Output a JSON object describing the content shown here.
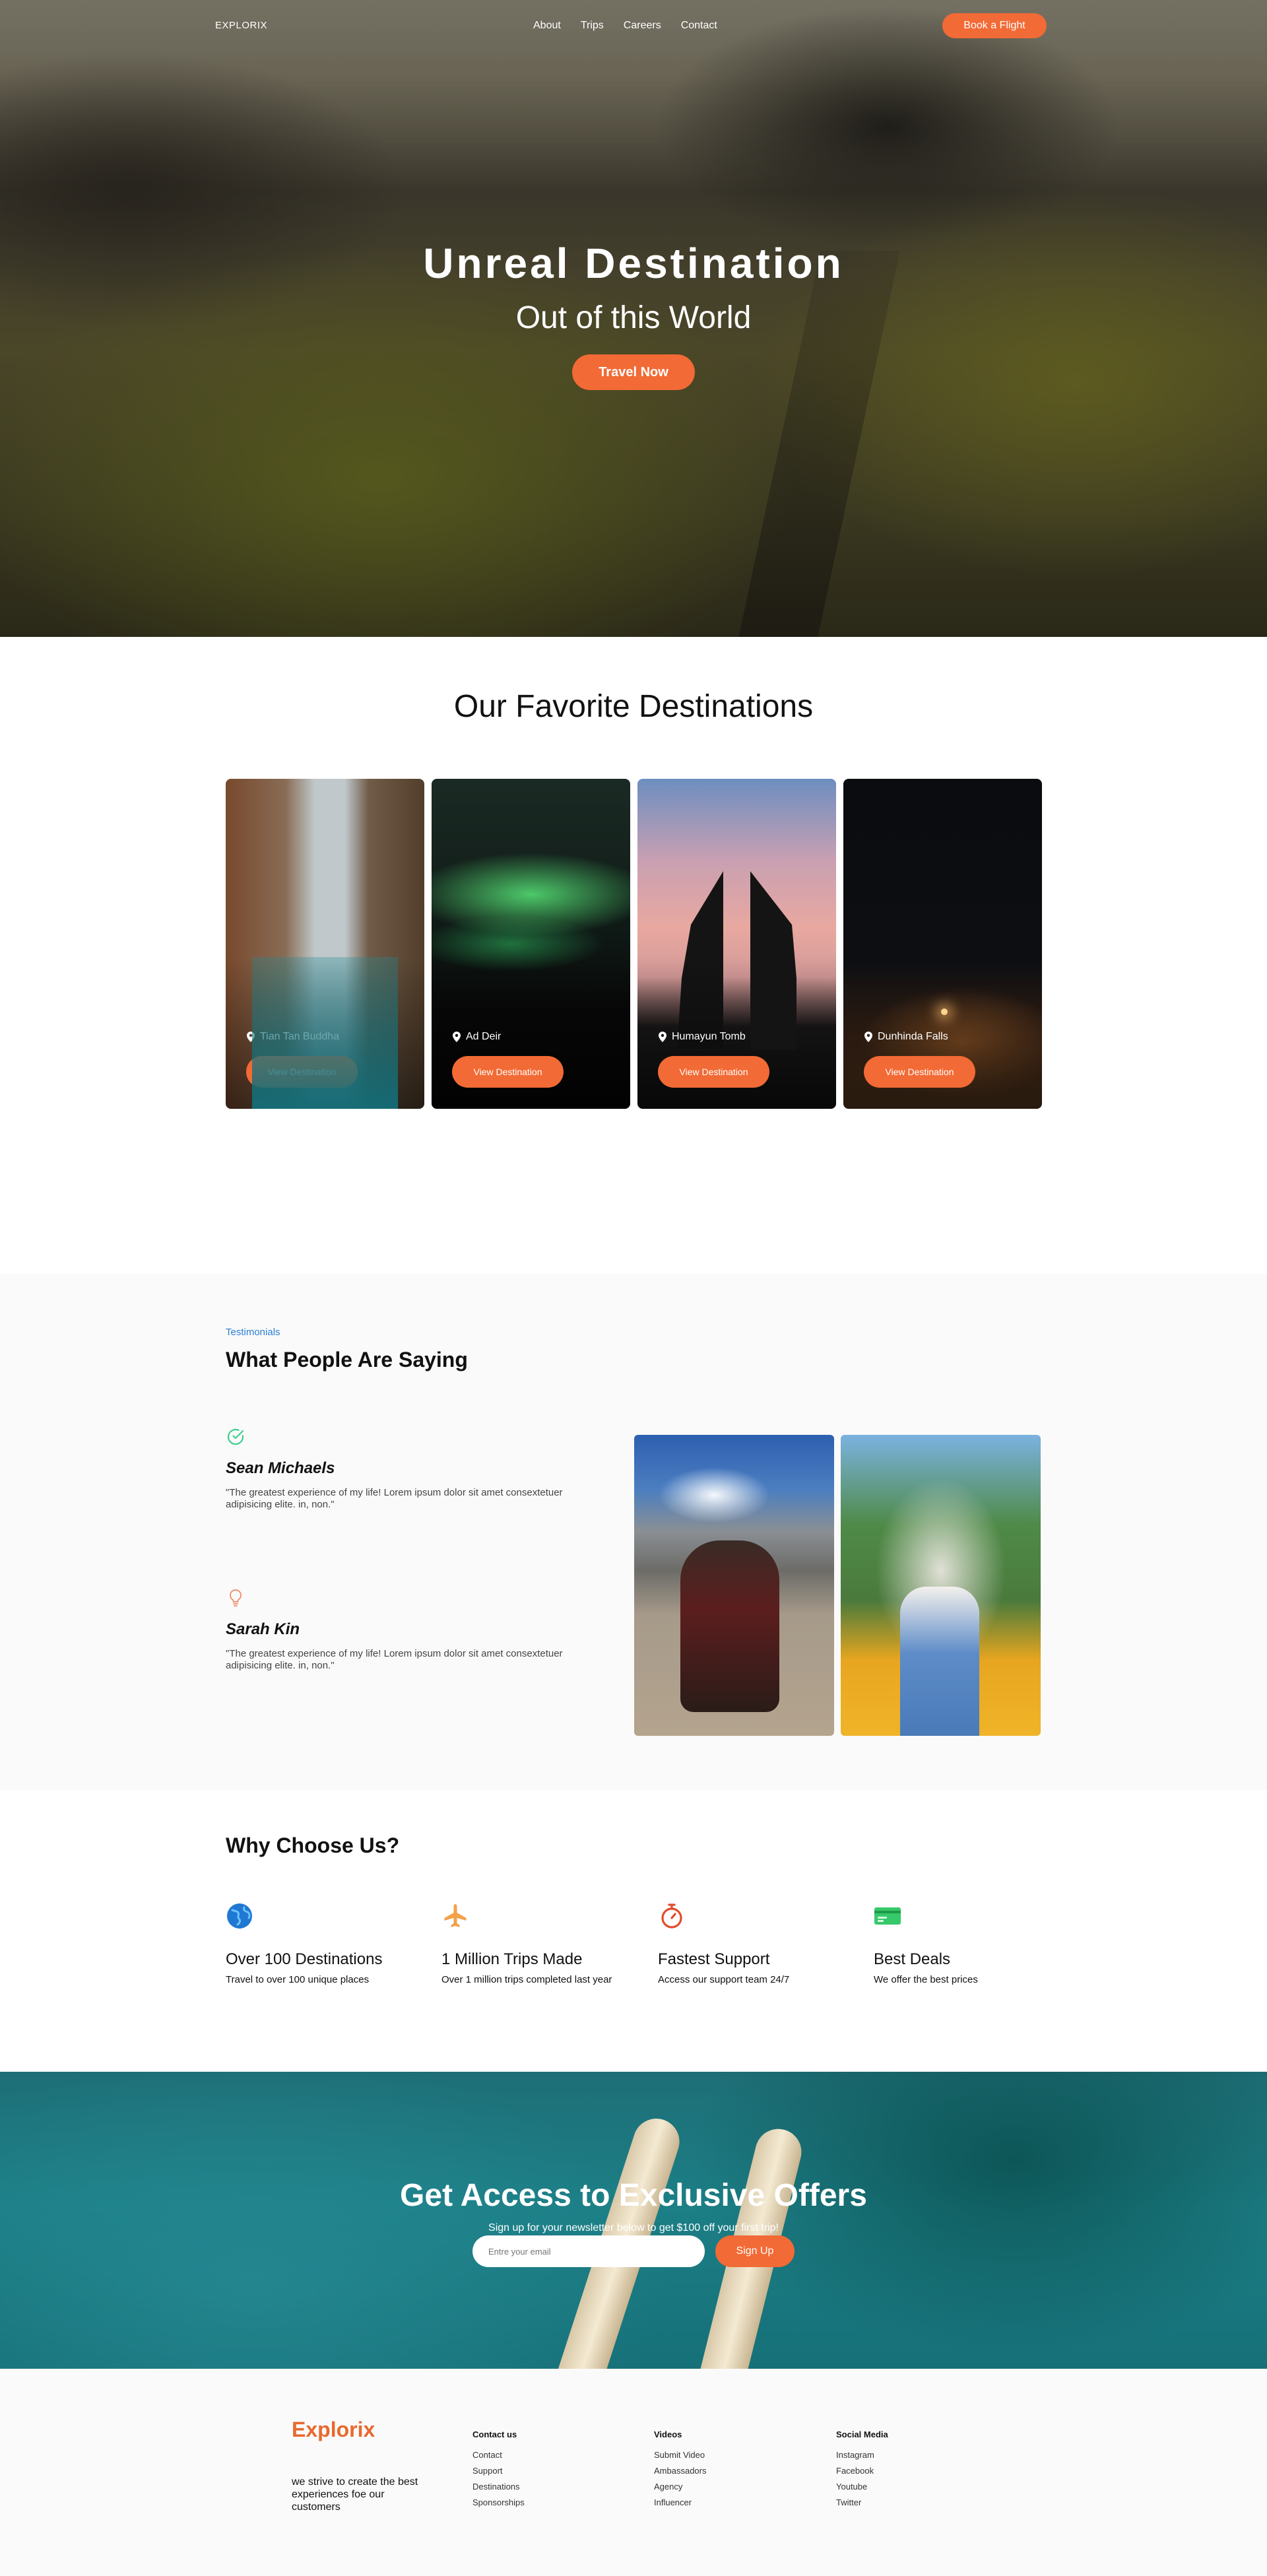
{
  "nav": {
    "logo": "EXPLORIX",
    "links": [
      "About",
      "Trips",
      "Careers",
      "Contact"
    ],
    "cta": "Book a Flight"
  },
  "hero": {
    "title": "Unreal Destination",
    "subtitle": "Out of this World",
    "cta": "Travel Now"
  },
  "destinations": {
    "heading": "Our Favorite Destinations",
    "cards": [
      {
        "location": "Tian Tan Buddha",
        "button": "View Destination"
      },
      {
        "location": "Ad Deir",
        "button": "View Destination"
      },
      {
        "location": "Humayun Tomb",
        "button": "View Destination"
      },
      {
        "location": "Dunhinda Falls",
        "button": "View Destination"
      }
    ]
  },
  "testimonials": {
    "eyebrow": "Testimonials",
    "heading": "What People Are Saying",
    "items": [
      {
        "icon": "check-circle-icon",
        "name": "Sean Michaels",
        "quote": "\"The greatest experience of my life! Lorem ipsum dolor sit amet consextetuer adipisicing elite. in, non.\""
      },
      {
        "icon": "lightbulb-icon",
        "name": "Sarah Kin",
        "quote": "\"The greatest experience of my life! Lorem ipsum dolor sit amet consextetuer adipisicing elite. in, non.\""
      }
    ]
  },
  "why": {
    "heading": "Why Choose Us?",
    "features": [
      {
        "icon": "globe-icon",
        "title": "Over 100 Destinations",
        "desc": "Travel to over 100 unique places"
      },
      {
        "icon": "plane-icon",
        "title": "1 Million Trips Made",
        "desc": "Over 1 million trips completed last year"
      },
      {
        "icon": "stopwatch-icon",
        "title": "Fastest Support",
        "desc": "Access our support team 24/7"
      },
      {
        "icon": "credit-card-icon",
        "title": "Best Deals",
        "desc": "We offer the best prices"
      }
    ]
  },
  "offers": {
    "heading": "Get Access to Exclusive Offers",
    "subtitle": "Sign up for your newsletter below to get $100 off your first trip!",
    "email_placeholder": "Entre your email",
    "button": "Sign Up"
  },
  "footer": {
    "logo": "Explorix",
    "tagline": "we strive to create the best experiences foe our customers",
    "columns": [
      {
        "title": "Contact us",
        "links": [
          "Contact",
          "Support",
          "Destinations",
          "Sponsorships"
        ]
      },
      {
        "title": "Videos",
        "links": [
          "Submit Video",
          "Ambassadors",
          "Agency",
          "Influencer"
        ]
      },
      {
        "title": "Social Media",
        "links": [
          "Instagram",
          "Facebook",
          "Youtube",
          "Twitter"
        ]
      }
    ]
  },
  "colors": {
    "accent": "#f26a35",
    "eyebrow": "#2c7fd4",
    "footer_logo": "#e8692e"
  }
}
